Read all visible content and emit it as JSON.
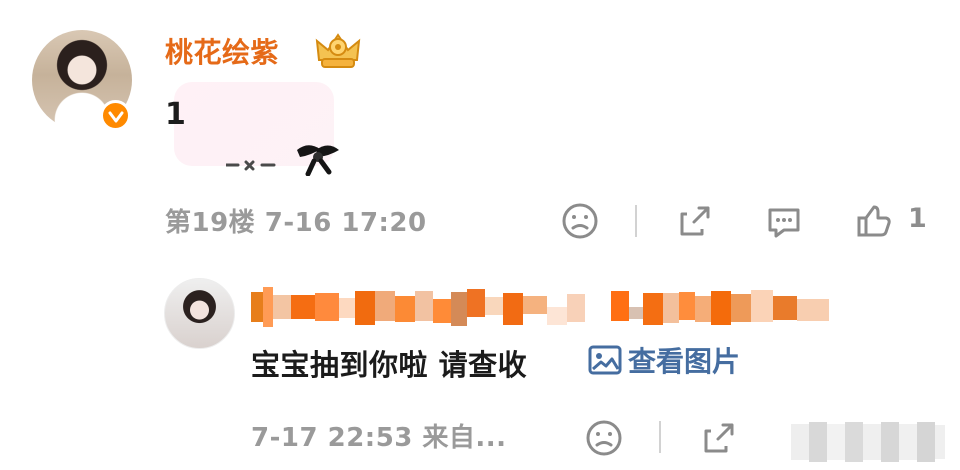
{
  "comment": {
    "username": "桃花绘紫",
    "text": "1",
    "floor_time": "第19楼 7-16 17:20",
    "like_count": "1"
  },
  "reply": {
    "text": "宝宝抽到你啦 请查收",
    "link_label": "查看图片",
    "meta": "7-17 22:53 来自..."
  },
  "icons": {
    "main_avatar": "avatar",
    "verified": "verified-badge-icon",
    "crown": "crown-icon",
    "sad_face": "sad-face-icon",
    "share": "share-icon",
    "comment": "comment-icon",
    "like": "thumbs-up-icon",
    "image": "image-icon"
  },
  "colors": {
    "username": "#e56a18",
    "meta": "#9a9a9a",
    "link": "#456da0",
    "badge": "#ff8a00"
  }
}
